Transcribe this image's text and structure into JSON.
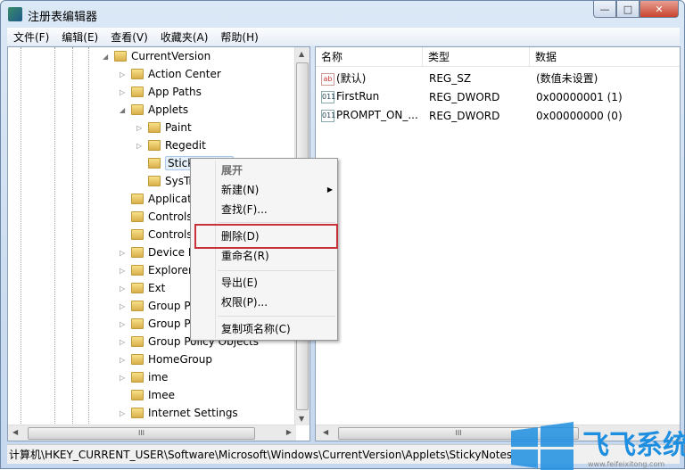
{
  "window": {
    "title": "注册表编辑器",
    "controls": {
      "minimize": "—",
      "maximize": "□",
      "close": "✕"
    }
  },
  "menu": [
    "文件(F)",
    "编辑(E)",
    "查看(V)",
    "收藏夹(A)",
    "帮助(H)"
  ],
  "tree": [
    {
      "label": "CurrentVersion",
      "level": 0,
      "expander": "◢"
    },
    {
      "label": "Action Center",
      "level": 1,
      "expander": "▷"
    },
    {
      "label": "App Paths",
      "level": 1,
      "expander": "▷"
    },
    {
      "label": "Applets",
      "level": 1,
      "expander": "◢"
    },
    {
      "label": "Paint",
      "level": 2,
      "expander": "▷"
    },
    {
      "label": "Regedit",
      "level": 2,
      "expander": "▷"
    },
    {
      "label": "StickyNotes",
      "level": 2,
      "expander": "",
      "selected": true
    },
    {
      "label": "SysTray",
      "level": 2,
      "expander": ""
    },
    {
      "label": "Application",
      "level": 1,
      "expander": ""
    },
    {
      "label": "Controls Folder",
      "level": 1,
      "expander": ""
    },
    {
      "label": "Controls Folder (Wow64)",
      "level": 1,
      "expander": ""
    },
    {
      "label": "Device Metadata",
      "level": 1,
      "expander": "▷"
    },
    {
      "label": "Explorer",
      "level": 1,
      "expander": "▷"
    },
    {
      "label": "Ext",
      "level": 1,
      "expander": "▷"
    },
    {
      "label": "Group Policy",
      "level": 1,
      "expander": "▷"
    },
    {
      "label": "Group Policy Editor",
      "level": 1,
      "expander": "▷"
    },
    {
      "label": "Group Policy Objects",
      "level": 1,
      "expander": "▷"
    },
    {
      "label": "HomeGroup",
      "level": 1,
      "expander": "▷"
    },
    {
      "label": "ime",
      "level": 1,
      "expander": "▷"
    },
    {
      "label": "Imee",
      "level": 1,
      "expander": ""
    },
    {
      "label": "Internet Settings",
      "level": 1,
      "expander": "▷"
    }
  ],
  "values": {
    "columns": [
      "名称",
      "类型",
      "数据"
    ],
    "rows": [
      {
        "icon": "ab",
        "name": "(默认)",
        "type": "REG_SZ",
        "data": "(数值未设置)"
      },
      {
        "icon": "dword",
        "name": "FirstRun",
        "type": "REG_DWORD",
        "data": "0x00000001 (1)"
      },
      {
        "icon": "dword",
        "name": "PROMPT_ON_...",
        "type": "REG_DWORD",
        "data": "0x00000000 (0)"
      }
    ]
  },
  "context_menu": {
    "items": [
      {
        "label": "展开",
        "disabled": true
      },
      {
        "label": "新建(N)",
        "submenu": true
      },
      {
        "label": "查找(F)..."
      },
      {
        "label": "删除(D)",
        "highlighted": true
      },
      {
        "label": "重命名(R)"
      },
      {
        "label": "导出(E)"
      },
      {
        "label": "权限(P)..."
      },
      {
        "label": "复制项名称(C)"
      }
    ],
    "highlight_color": "#c8303a"
  },
  "status": "计算机\\HKEY_CURRENT_USER\\Software\\Microsoft\\Windows\\CurrentVersion\\Applets\\StickyNotes",
  "watermark": {
    "text": "飞飞系统",
    "url": "www.feifeixitong.com",
    "color": "#1e8fe0"
  }
}
